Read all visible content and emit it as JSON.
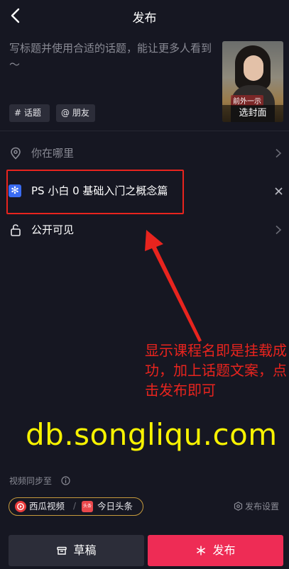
{
  "header": {
    "title": "发布",
    "back_icon": "chevron-left-icon"
  },
  "caption": {
    "placeholder": "写标题并使用合适的话题，能让更多人看到～"
  },
  "cover": {
    "sticker_text": "前外一示",
    "button_label": "选封面"
  },
  "chips": {
    "topic": "# 话题",
    "friend": "@ 朋友"
  },
  "location": {
    "label": "你在哪里",
    "icon": "location-pin-icon"
  },
  "course": {
    "label": "PS 小白 0 基础入门之概念篇",
    "icon": "course-icon",
    "icon_color": "#3a6cf2"
  },
  "visibility": {
    "label": "公开可见",
    "icon": "lock-icon"
  },
  "annotation": {
    "text": "显示课程名即是挂载成功，加上话题文案，点击发布即可",
    "color": "#e8241e"
  },
  "watermark": {
    "text": "db.songliqu.com",
    "color": "#f7f200"
  },
  "sync": {
    "label": "视频同步至",
    "apps": [
      "西瓜视频",
      "今日头条"
    ],
    "settings_label": "发布设置"
  },
  "actions": {
    "draft_label": "草稿",
    "publish_label": "发布",
    "publish_color": "#ee2c55"
  }
}
